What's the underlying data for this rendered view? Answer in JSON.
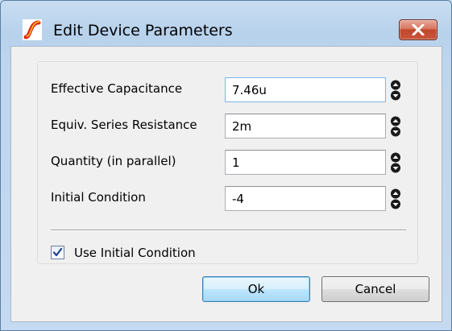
{
  "window": {
    "title": "Edit Device Parameters",
    "icon": "simetrix-logo-icon"
  },
  "params": [
    {
      "label": "Effective Capacitance",
      "value": "7.46u"
    },
    {
      "label": "Equiv. Series Resistance",
      "value": "2m"
    },
    {
      "label": "Quantity (in parallel)",
      "value": "1"
    },
    {
      "label": "Initial Condition",
      "value": "-4"
    }
  ],
  "use_initial_condition": {
    "label": "Use Initial Condition",
    "checked": true
  },
  "buttons": {
    "ok": "Ok",
    "cancel": "Cancel"
  },
  "colors": {
    "titlebar": "#c8ddf1",
    "close_button": "#c9553b",
    "default_button": "#bee6fd",
    "client": "#f0f0f0"
  }
}
